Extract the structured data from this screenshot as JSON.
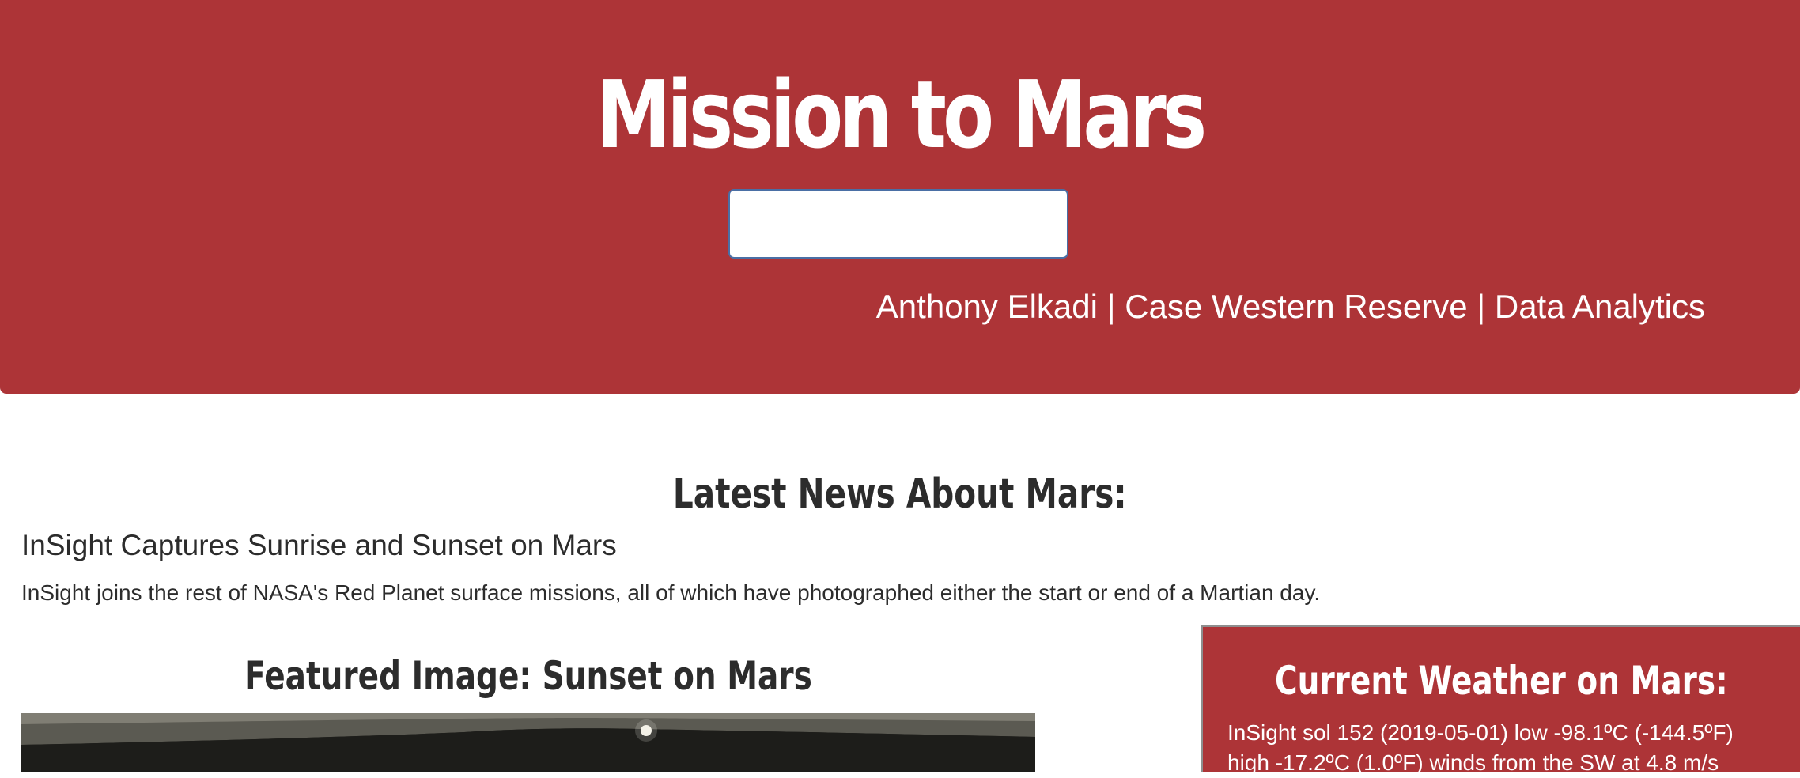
{
  "header": {
    "title": "Mission to Mars",
    "button_label": "",
    "author_line": "Anthony Elkadi | Case Western Reserve | Data Analytics",
    "background_color": "#ad3437"
  },
  "news": {
    "section_heading": "Latest News About Mars:",
    "title": "InSight Captures Sunrise and Sunset on Mars",
    "teaser": "InSight joins the rest of NASA's Red Planet surface missions, all of which have photographed either the start or end of a Martian day."
  },
  "featured_image": {
    "heading": "Featured Image: Sunset on Mars"
  },
  "weather": {
    "heading": "Current Weather on Mars:",
    "report": "InSight sol 152 (2019-05-01) low -98.1ºC (-144.5ºF) high -17.2ºC (1.0ºF) winds from the SW at 4.8 m/s"
  }
}
